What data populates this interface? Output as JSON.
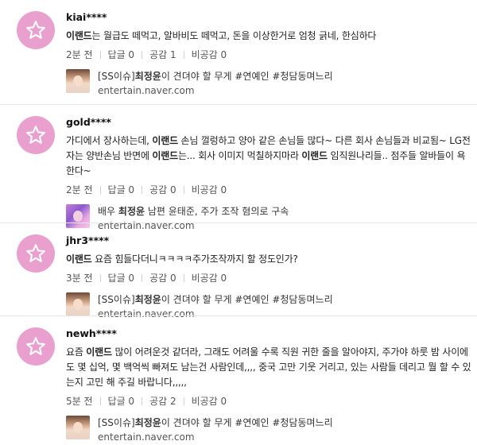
{
  "comments": [
    {
      "username": "kiai****",
      "text_html": "<b>이랜드</b>는 월급도 떼먹고, 알바비도 떼먹고, 돈을 이상한거로 엄청 긁네, 한심하다",
      "time": "2분 전",
      "reply": "답글 0",
      "like": "공감 1",
      "dislike": "비공감 0",
      "link_title_html": "[SS이슈]<b>최정윤</b>이 견뎌야 할 무게 #연예인 #청담동며느리",
      "link_domain": "entertain.naver.com"
    },
    {
      "username": "gold****",
      "text_html": "가디에서 장사하는데, <b>이랜드</b> 손님 껄렁하고 양아 같은 손님들 많다~ 다른 회사 손님들과 비교됨~ LG전자는 양반손님 반면에 <b>이랜드</b>는... 회사 이미지 먹칠하지마라 <b>이랜드</b> 임직원나리들.. 점주들 알바들이 욕한다~",
      "time": "2분 전",
      "reply": "답글 0",
      "like": "공감 0",
      "dislike": "비공감 0",
      "link_title_html": "배우 <b>최정윤</b> 남편 윤태준, 주가 조작 혐의로 구속",
      "link_domain": "entertain.naver.com"
    },
    {
      "username": "jhr3****",
      "text_html": "<b>이랜드</b> 요즘 힘들다더니ㅋㅋㅋㅋ주가조작까지 할 정도인가?",
      "time": "3분 전",
      "reply": "답글 0",
      "like": "공감 0",
      "dislike": "비공감 0",
      "link_title_html": "[SS이슈]<b>최정윤</b>이 견뎌야 할 무게 #연예인 #청담동며느리",
      "link_domain": "entertain.naver.com"
    },
    {
      "username": "newh****",
      "text_html": "요즘 <b>이랜드</b> 많이 어려운것 같더라, 그래도 어려울 수록 직원 귀한 줄을 알아야지, 주가야 하룻 밤 사이에도 몇 십억, 몇 백억씩 빠져도 남는건 사람인데,,,, 중국 고만 기웃 거리고, 있는 사람들 데리고 뭘 할 수 있는지 고민 해 주길 바랍니다,,,,,",
      "time": "5분 전",
      "reply": "답글 0",
      "like": "공감 2",
      "dislike": "비공감 0",
      "link_title_html": "[SS이슈]<b>최정윤</b>이 견뎌야 할 무게 #연예인 #청담동며느리",
      "link_domain": "entertain.naver.com"
    }
  ],
  "avatar_icon": "star-outline-icon",
  "colors": {
    "avatar_bg": "#e9a0cf",
    "divider": "#e6e6e6"
  }
}
